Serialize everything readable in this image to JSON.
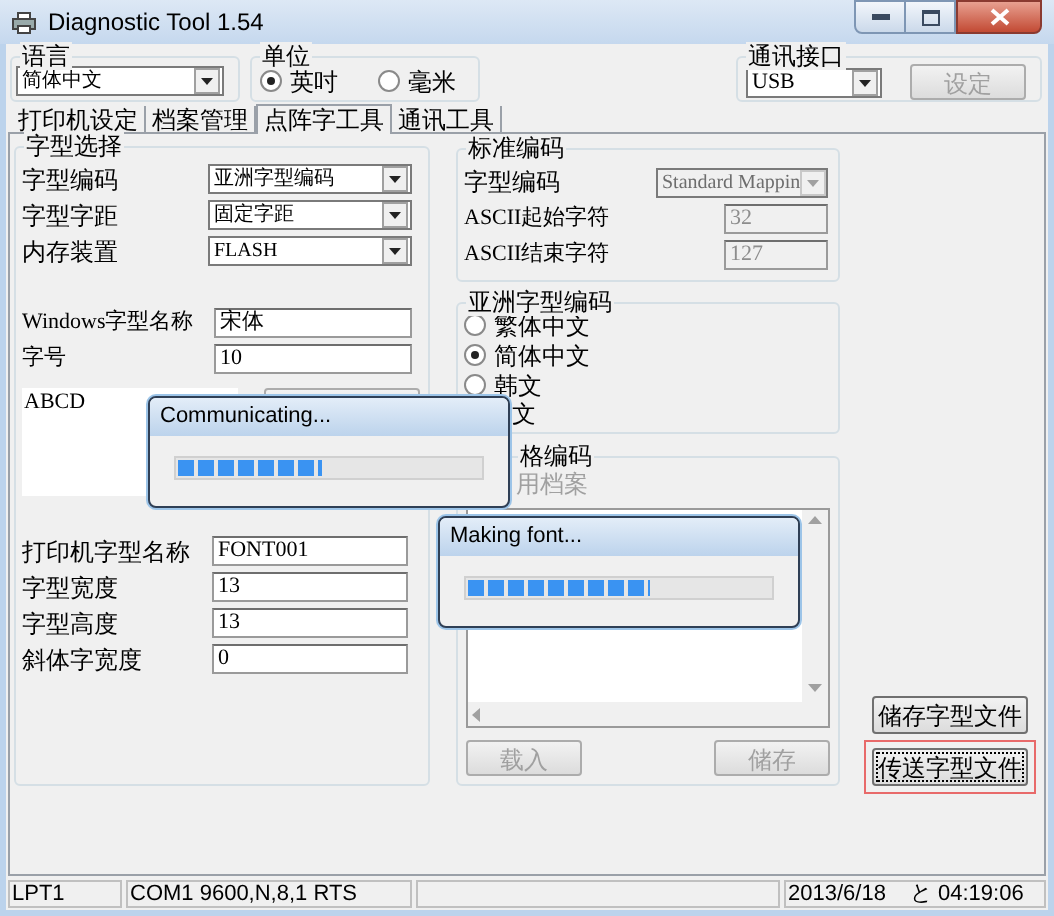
{
  "window": {
    "title": "Diagnostic Tool 1.54"
  },
  "language": {
    "label": "语言",
    "value": "简体中文"
  },
  "unit": {
    "label": "单位",
    "options": [
      {
        "label": "英吋",
        "selected": true
      },
      {
        "label": "毫米",
        "selected": false
      }
    ]
  },
  "port": {
    "label": "通讯接口",
    "value": "USB",
    "button": {
      "label": "设定",
      "disabled": true
    }
  },
  "tabs": [
    {
      "label": "打印机设定",
      "selected": false
    },
    {
      "label": "档案管理",
      "selected": false
    },
    {
      "label": "点阵字工具",
      "selected": true
    },
    {
      "label": "通讯工具",
      "selected": false
    }
  ],
  "font_select": {
    "title": "字型选择",
    "dropdowns": [
      {
        "label": "字型编码",
        "value": "亚洲字型编码"
      },
      {
        "label": "字型字距",
        "value": "固定字距"
      },
      {
        "label": "内存装置",
        "value": "FLASH"
      }
    ],
    "windows_fields": [
      {
        "label": "Windows字型名称",
        "value": "宋体"
      },
      {
        "label": "字号",
        "value": "10"
      }
    ],
    "preview": "ABCD",
    "printer_fields": [
      {
        "label": "打印机字型名称",
        "value": "FONT001"
      },
      {
        "label": "字型宽度",
        "value": "13"
      },
      {
        "label": "字型高度",
        "value": "13"
      },
      {
        "label": "斜体字宽度",
        "value": "0"
      }
    ]
  },
  "standard_encoding": {
    "title": "标准编码",
    "rows": [
      {
        "kind": "dropdown",
        "label": "字型编码",
        "value": "Standard Mappin",
        "disabled": true
      },
      {
        "kind": "field",
        "label": "ASCII起始字符",
        "value": "32",
        "disabled": true
      },
      {
        "kind": "field",
        "label": "ASCII结束字符",
        "value": "127",
        "disabled": true
      }
    ]
  },
  "asian_encoding": {
    "title": "亚洲字型编码",
    "options": [
      {
        "label": "繁体中文",
        "selected": false
      },
      {
        "label": "简体中文",
        "selected": true
      },
      {
        "label": "韩文",
        "selected": false
      }
    ],
    "cut_option": "文"
  },
  "table_encoding": {
    "title": "格编码",
    "option": {
      "label": "用档案",
      "disabled": true
    },
    "buttons": [
      {
        "label": "载入",
        "disabled": true
      },
      {
        "label": "储存",
        "disabled": true
      }
    ]
  },
  "side_buttons": [
    {
      "label": "储存字型文件",
      "focused": false,
      "highlighted": false
    },
    {
      "label": "传送字型文件",
      "focused": true,
      "highlighted": true
    }
  ],
  "dialogs": [
    {
      "title": "Communicating...",
      "level": 0.48
    },
    {
      "title": "Making font...",
      "level": 0.6
    }
  ],
  "status_bar": {
    "port": "LPT1",
    "serial": "COM1 9600,N,8,1 RTS",
    "date": "2013/6/18",
    "time": "と 04:19:06"
  }
}
